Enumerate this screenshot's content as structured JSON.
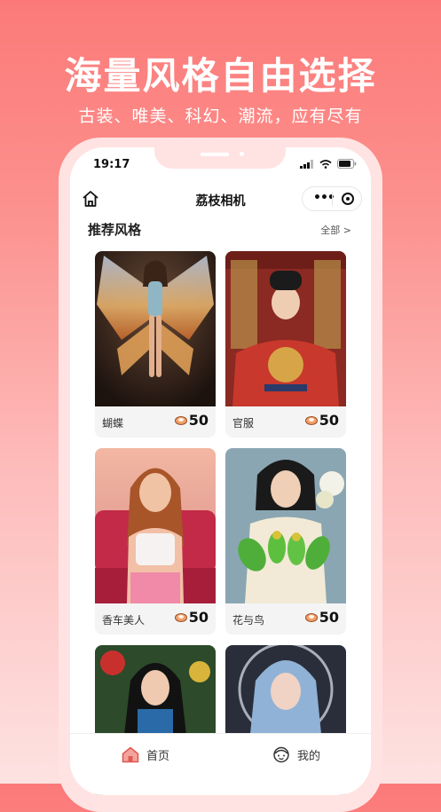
{
  "promo": {
    "headline": "海量风格自由选择",
    "subline": "古装、唯美、科幻、潮流，应有尽有"
  },
  "status_bar": {
    "time": "19:17"
  },
  "header": {
    "title": "荔枝相机",
    "more": "•••"
  },
  "section": {
    "title": "推荐风格",
    "see_all": "全部 >"
  },
  "cards": [
    {
      "name": "蝴蝶",
      "price": "50"
    },
    {
      "name": "官服",
      "price": "50"
    },
    {
      "name": "香车美人",
      "price": "50"
    },
    {
      "name": "花与鸟",
      "price": "50"
    },
    {
      "name": "",
      "price": ""
    },
    {
      "name": "",
      "price": ""
    }
  ],
  "tabbar": {
    "home": "首页",
    "mine": "我的"
  },
  "colors": {
    "accent": "#fb7a79",
    "tab_active": "#e05a52"
  },
  "icons": [
    "home-outline-icon",
    "more-dots-icon",
    "close-circle-icon",
    "coin-icon",
    "home-tab-icon",
    "mine-tab-icon",
    "signal-icon",
    "wifi-icon",
    "battery-icon"
  ]
}
